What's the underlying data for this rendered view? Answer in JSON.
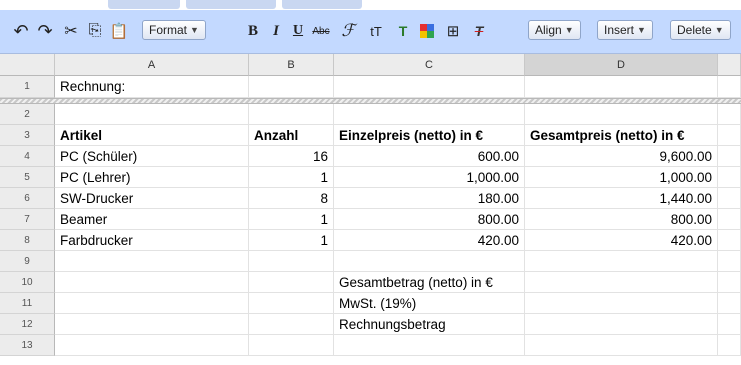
{
  "toolbar": {
    "undo": "↶",
    "redo": "↷",
    "cut": "✂",
    "copy": "⎘",
    "paste": "📋",
    "format_label": "Format",
    "bold": "B",
    "italic": "I",
    "underline": "U",
    "strike": "Abc",
    "font": "ℱ",
    "font_size": "tT",
    "text_color": "T",
    "borders": "⊞",
    "clear_format": "T",
    "align_label": "Align",
    "insert_label": "Insert",
    "delete_label": "Delete"
  },
  "columns": [
    "A",
    "B",
    "C",
    "D"
  ],
  "rows": [
    {
      "num": "1",
      "a": "Rechnung:",
      "b": "",
      "c": "",
      "d": ""
    },
    {
      "num": "2",
      "a": "",
      "b": "",
      "c": "",
      "d": ""
    },
    {
      "num": "3",
      "a": "Artikel",
      "b": "Anzahl",
      "c": "Einzelpreis (netto) in €",
      "d": "Gesamtpreis (netto) in €"
    },
    {
      "num": "4",
      "a": "PC (Schüler)",
      "b": "16",
      "c": "600.00",
      "d": "9,600.00"
    },
    {
      "num": "5",
      "a": "PC (Lehrer)",
      "b": "1",
      "c": "1,000.00",
      "d": "1,000.00"
    },
    {
      "num": "6",
      "a": "SW-Drucker",
      "b": "8",
      "c": "180.00",
      "d": "1,440.00"
    },
    {
      "num": "7",
      "a": "Beamer",
      "b": "1",
      "c": "800.00",
      "d": "800.00"
    },
    {
      "num": "8",
      "a": "Farbdrucker",
      "b": "1",
      "c": "420.00",
      "d": "420.00"
    },
    {
      "num": "9",
      "a": "",
      "b": "",
      "c": "",
      "d": ""
    },
    {
      "num": "10",
      "a": "",
      "b": "",
      "c": "Gesamtbetrag (netto) in €",
      "d": ""
    },
    {
      "num": "11",
      "a": "",
      "b": "",
      "c": "MwSt. (19%)",
      "d": ""
    },
    {
      "num": "12",
      "a": "",
      "b": "",
      "c": "Rechnungsbetrag",
      "d": ""
    },
    {
      "num": "13",
      "a": "",
      "b": "",
      "c": "",
      "d": ""
    }
  ],
  "selected_column": "D",
  "colors": {
    "toolbar_bg": "#c3d9ff",
    "header_bg": "#ececec",
    "selected_header": "#d4d4d4"
  }
}
